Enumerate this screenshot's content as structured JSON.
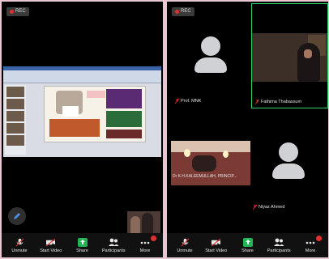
{
  "left": {
    "rec_label": "REC",
    "toolbar": [
      {
        "id": "unmute",
        "label": "Unmute",
        "icon": "mic-muted-icon"
      },
      {
        "id": "video",
        "label": "Start Video",
        "icon": "video-off-icon"
      },
      {
        "id": "share",
        "label": "Share",
        "icon": "share-icon"
      },
      {
        "id": "participants",
        "label": "Participants",
        "icon": "participants-icon"
      },
      {
        "id": "more",
        "label": "More",
        "icon": "more-icon"
      }
    ],
    "more_badge": ""
  },
  "right": {
    "rec_label": "REC",
    "tiles": [
      {
        "name": "Prof. MNK",
        "muted": true
      },
      {
        "name": "Fathima Thabassum",
        "muted": true
      },
      {
        "name": "Dr K.H.KALEEMULLAH, PRINCIP...",
        "muted": true
      },
      {
        "name": "Niyaz Ahmed",
        "muted": true
      }
    ],
    "toolbar": [
      {
        "id": "unmute",
        "label": "Unmute",
        "icon": "mic-muted-icon"
      },
      {
        "id": "video",
        "label": "Start Video",
        "icon": "video-off-icon"
      },
      {
        "id": "share",
        "label": "Share",
        "icon": "share-icon"
      },
      {
        "id": "participants",
        "label": "Participants",
        "icon": "participants-icon"
      },
      {
        "id": "more",
        "label": "More",
        "icon": "more-icon"
      }
    ],
    "more_badge": ""
  },
  "colors": {
    "accent_green": "#2fd36c",
    "rec_red": "#e0302f",
    "share_green": "#22b455"
  }
}
